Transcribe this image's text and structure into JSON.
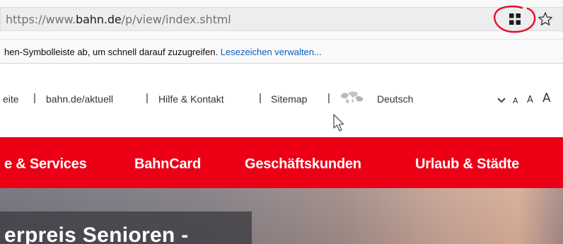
{
  "browser": {
    "url_prefix": "https://www.",
    "url_domain": "bahn.de",
    "url_path": "/p/view/index.shtml",
    "bookmarks_hint": "hen-Symbolleiste ab, um schnell darauf zuzugreifen.",
    "bookmarks_link": "Lesezeichen verwalten..."
  },
  "meta_nav": {
    "items": [
      "eite",
      "bahn.de/aktuell",
      "Hilfe & Kontakt",
      "Sitemap"
    ],
    "separator": "|",
    "language": "Deutsch",
    "font_sizes": [
      "A",
      "A",
      "A"
    ]
  },
  "main_nav": {
    "items": [
      "e & Services",
      "BahnCard",
      "Geschäftskunden",
      "Urlaub & Städte"
    ]
  },
  "hero": {
    "title": "erpreis Senioren -"
  },
  "colors": {
    "brand_red": "#ec0016",
    "annotation_red": "#e8102a",
    "link_blue": "#0a5fc4"
  },
  "icons": [
    "reader-view-icon",
    "bookmark-star-icon",
    "globe-icon",
    "chevron-down-icon",
    "mouse-cursor-icon"
  ]
}
